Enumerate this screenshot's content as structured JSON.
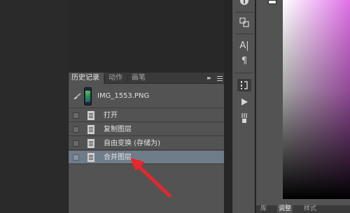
{
  "history_panel": {
    "tabs": [
      {
        "label": "历史记录",
        "active": true
      },
      {
        "label": "动作",
        "active": false
      },
      {
        "label": "画笔",
        "active": false
      }
    ],
    "snapshot": {
      "name": "IMG_1553.PNG"
    },
    "steps": [
      {
        "label": "打开",
        "selected": false
      },
      {
        "label": "复制图层",
        "selected": false
      },
      {
        "label": "自由变换 (存储为)",
        "selected": false
      },
      {
        "label": "合并图层",
        "selected": true
      }
    ]
  },
  "tool_strip": {
    "character_icon": "A|",
    "paragraph_icon": "¶"
  },
  "bottom_tabs": [
    "库",
    "调整",
    "样式"
  ],
  "colors": {
    "panel": "#535353",
    "selection": "#6f7c8a",
    "annotation_arrow": "#e8262b"
  }
}
